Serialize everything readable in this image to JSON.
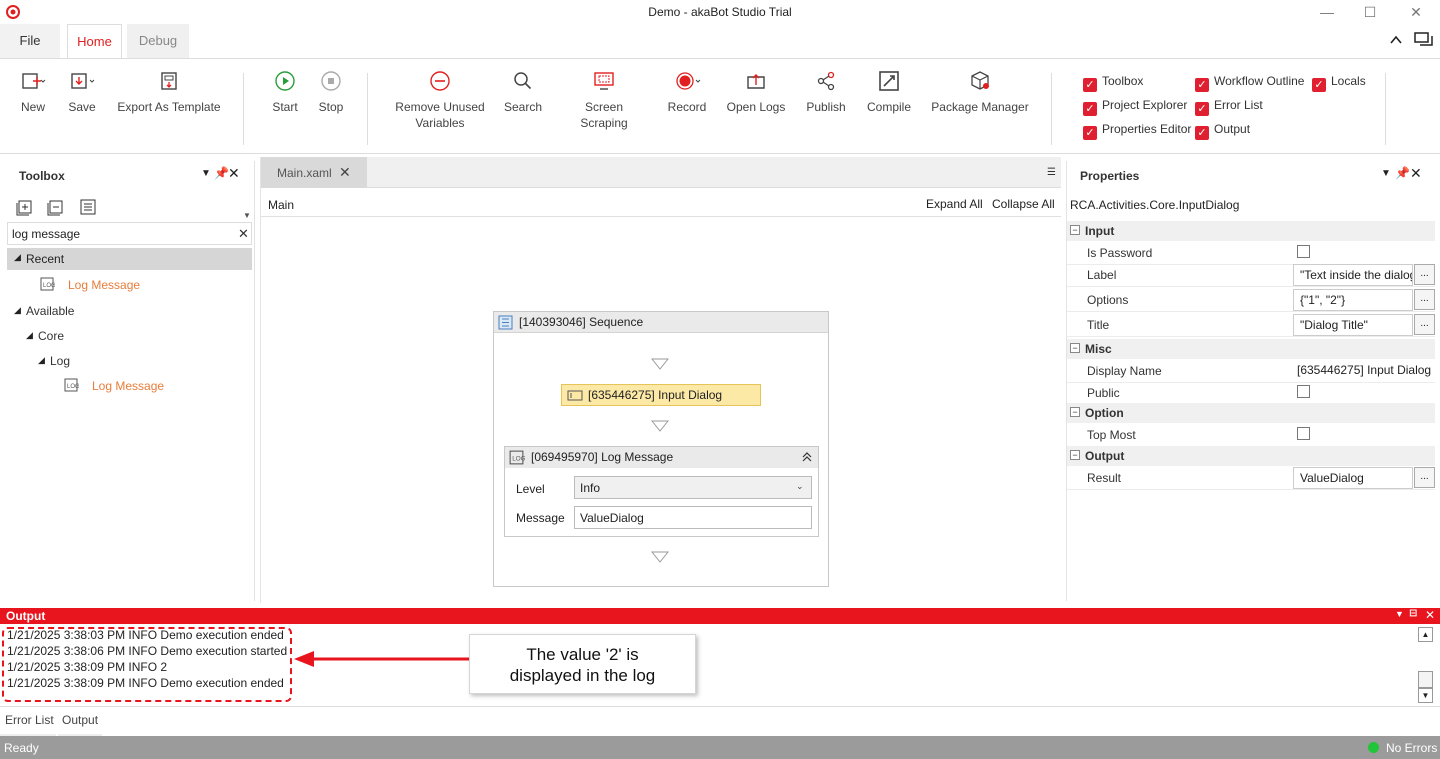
{
  "window": {
    "title": "Demo - akaBot Studio Trial"
  },
  "menu_tabs": {
    "file": "File",
    "home": "Home",
    "debug": "Debug"
  },
  "ribbon": {
    "new": "New",
    "save": "Save",
    "export_template": "Export As Template",
    "start": "Start",
    "stop": "Stop",
    "remove_unused_line1": "Remove Unused",
    "remove_unused_line2": "Variables",
    "search": "Search",
    "screen_scraping": "Screen Scraping",
    "record": "Record",
    "open_logs": "Open Logs",
    "publish": "Publish",
    "compile": "Compile",
    "package_manager": "Package Manager"
  },
  "view_toggles": {
    "toolbox": "Toolbox",
    "project_explorer": "Project Explorer",
    "properties_editor": "Properties Editor",
    "workflow_outline": "Workflow Outline",
    "error_list": "Error List",
    "output": "Output",
    "locals": "Locals"
  },
  "toolbox": {
    "title": "Toolbox",
    "search_value": "log message",
    "recent": "Recent",
    "recent_item": "Log Message",
    "available": "Available",
    "core": "Core",
    "log": "Log",
    "log_item": "Log Message"
  },
  "designer": {
    "tab": "Main.xaml",
    "breadcrumb": "Main",
    "expand_all": "Expand All",
    "collapse_all": "Collapse All",
    "sequence_title": "[140393046] Sequence",
    "input_dialog": "[635446275] Input Dialog",
    "log_message_title": "[069495970] Log Message",
    "level_label": "Level",
    "level_value": "Info",
    "message_label": "Message",
    "message_value": "ValueDialog"
  },
  "properties": {
    "title": "Properties",
    "type_name": "RCA.Activities.Core.InputDialog",
    "cat_input": "Input",
    "is_password": "Is Password",
    "label": "Label",
    "label_value": "\"Text inside the dialog\"",
    "options": "Options",
    "options_value": "{\"1\", \"2\"}",
    "title_prop": "Title",
    "title_value": "\"Dialog Title\"",
    "cat_misc": "Misc",
    "display_name": "Display Name",
    "display_name_value": "[635446275] Input Dialog",
    "public": "Public",
    "cat_option": "Option",
    "top_most": "Top Most",
    "cat_output": "Output",
    "result": "Result",
    "result_value": "ValueDialog",
    "ellipsis": "..."
  },
  "output": {
    "title": "Output",
    "lines": [
      "1/21/2025 3:38:03 PM INFO Demo execution ended",
      "1/21/2025 3:38:06 PM INFO Demo execution started",
      "1/21/2025 3:38:09 PM INFO 2",
      "1/21/2025 3:38:09 PM INFO Demo execution ended"
    ],
    "callout_line1": "The value '2' is",
    "callout_line2": "displayed in the log"
  },
  "bottom_tabs": {
    "error_list": "Error List",
    "output": "Output"
  },
  "status": {
    "ready": "Ready",
    "errors": "No Errors"
  },
  "colors": {
    "accent": "#e02020",
    "output_header": "#e8141e",
    "status_bar": "#9b9b9b",
    "activity_highlight": "#fde9a6"
  }
}
